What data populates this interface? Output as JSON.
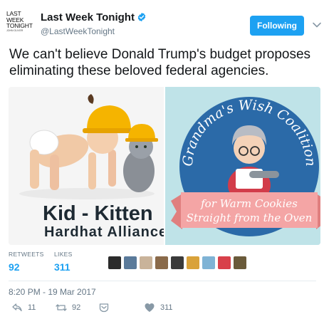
{
  "author": {
    "avatar_text": [
      "LAST",
      "WEEK",
      "TONIGHT"
    ],
    "avatar_subtext": "JOHN OLIVER",
    "name": "Last Week Tonight",
    "handle": "@LastWeekTonight",
    "verified": true
  },
  "follow_button": {
    "label": "Following",
    "color": "#1da1f2"
  },
  "tweet": {
    "text": "We can't believe Donald Trump's budget proposes eliminating these beloved federal agencies."
  },
  "media": {
    "left": {
      "line1": "Kid - Kitten",
      "line2": "Hardhat Alliance"
    },
    "right": {
      "arc_text": "Grandma's Wish Coalition",
      "banner_line1": "for Warm Cookies",
      "banner_line2": "Straight from the Oven"
    }
  },
  "stats": {
    "retweets_label": "RETWEETS",
    "retweets_value": "92",
    "likes_label": "LIKES",
    "likes_value": "311"
  },
  "timestamp": "8:20 PM - 19 Mar 2017",
  "actions": {
    "reply_count": "11",
    "retweet_count": "92",
    "like_count": "311"
  },
  "colors": {
    "accent": "#1da1f2",
    "muted": "#657786",
    "teal_bg": "#bfe3e8",
    "circle_blue": "#2b6aa8",
    "banner_pink": "#f4a5a5"
  }
}
